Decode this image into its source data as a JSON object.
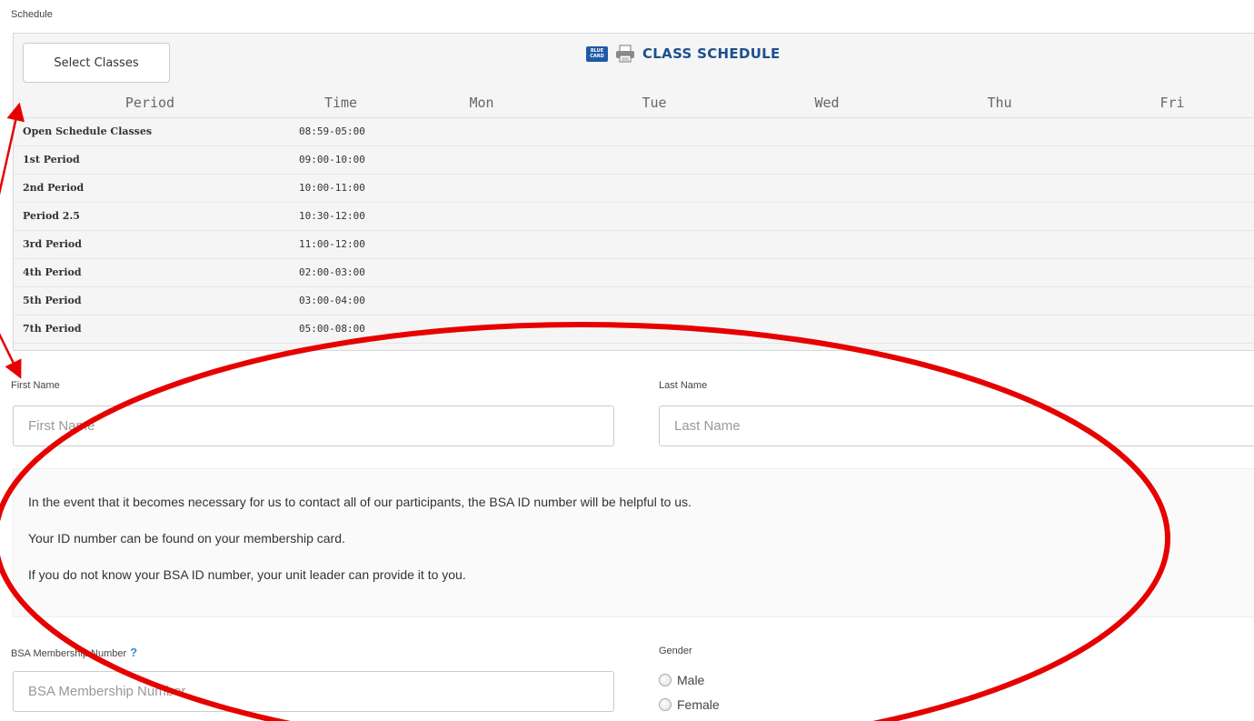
{
  "schedule_section": {
    "label": "Schedule",
    "select_button": "Select Classes",
    "bluecard_text": "BLUE CARD",
    "title": "CLASS SCHEDULE",
    "columns": [
      "Period",
      "Time",
      "Mon",
      "Tue",
      "Wed",
      "Thu",
      "Fri"
    ],
    "rows": [
      {
        "period": "Open Schedule Classes",
        "time": "08:59-05:00"
      },
      {
        "period": "1st Period",
        "time": "09:00-10:00"
      },
      {
        "period": "2nd Period",
        "time": "10:00-11:00"
      },
      {
        "period": "Period 2.5",
        "time": "10:30-12:00"
      },
      {
        "period": "3rd Period",
        "time": "11:00-12:00"
      },
      {
        "period": "4th Period",
        "time": "02:00-03:00"
      },
      {
        "period": "5th Period",
        "time": "03:00-04:00"
      },
      {
        "period": "7th Period",
        "time": "05:00-08:00"
      }
    ]
  },
  "form": {
    "first_name_label": "First Name",
    "first_name_placeholder": "First Name",
    "last_name_label": "Last Name",
    "last_name_placeholder": "Last Name",
    "info_lines": [
      "In the event that it becomes necessary for us to contact all of our participants, the BSA ID number will be helpful to us.",
      "Your ID number can be found on your membership card.",
      "If you do not know your BSA ID number, your unit leader can provide it to you."
    ],
    "bsa_label": "BSA Membership Number",
    "bsa_help": "?",
    "bsa_placeholder": "BSA Membership Number",
    "gender_label": "Gender",
    "gender_options": [
      "Male",
      "Female"
    ]
  },
  "annotation": {
    "color": "#e60000"
  }
}
